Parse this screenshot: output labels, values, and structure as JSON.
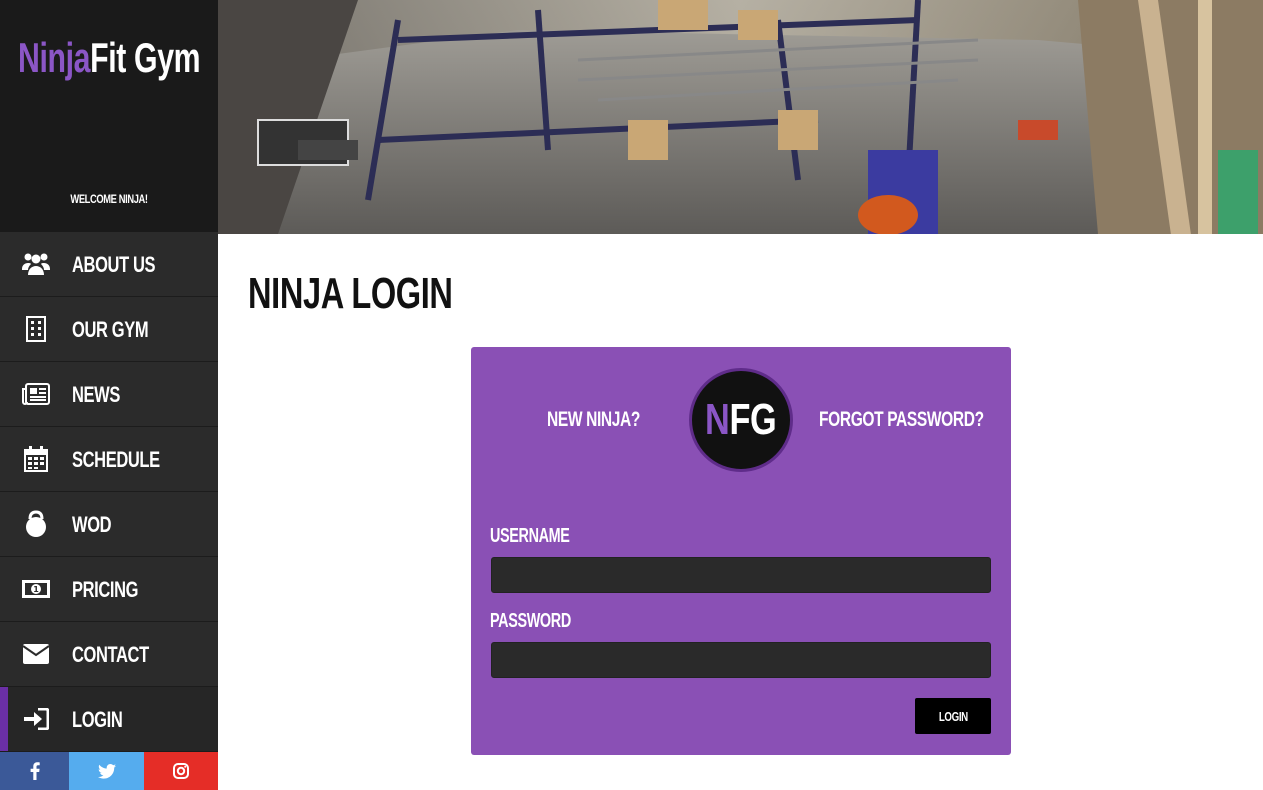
{
  "brand": {
    "logo_part1": "Ninja",
    "logo_part2": "Fit Gym",
    "welcome": "WELCOME NINJA!"
  },
  "nav": {
    "items": [
      {
        "label": "About Us",
        "icon": "users-icon"
      },
      {
        "label": "Our Gym",
        "icon": "building-icon"
      },
      {
        "label": "News",
        "icon": "newspaper-icon"
      },
      {
        "label": "Schedule",
        "icon": "calendar-icon"
      },
      {
        "label": "WOD",
        "icon": "kettlebell-icon"
      },
      {
        "label": "Pricing",
        "icon": "money-icon"
      },
      {
        "label": "Contact",
        "icon": "envelope-icon"
      },
      {
        "label": "Login",
        "icon": "sign-in-icon"
      }
    ],
    "active": "Login"
  },
  "social": {
    "facebook": "f",
    "twitter": "twitter-icon",
    "instagram": "instagram-icon",
    "colors": {
      "facebook": "#3b5998",
      "twitter": "#55acee",
      "instagram": "#e52d27"
    }
  },
  "hero": {
    "image": "gym-obstacle-course-photo"
  },
  "main": {
    "title": "Ninja Login",
    "new_ninja": "New Ninja?",
    "forgot_password": "Forgot Password?",
    "badge_n": "N",
    "badge_fg": "FG",
    "username_label": "Username",
    "username_value": "",
    "password_label": "Password",
    "password_value": "",
    "login_button": "Login"
  },
  "colors": {
    "accent": "#8a50b5",
    "sidebar": "#2b2b2b",
    "brand_bg": "#1a1a1a",
    "active_bar": "#6b2fa6"
  }
}
